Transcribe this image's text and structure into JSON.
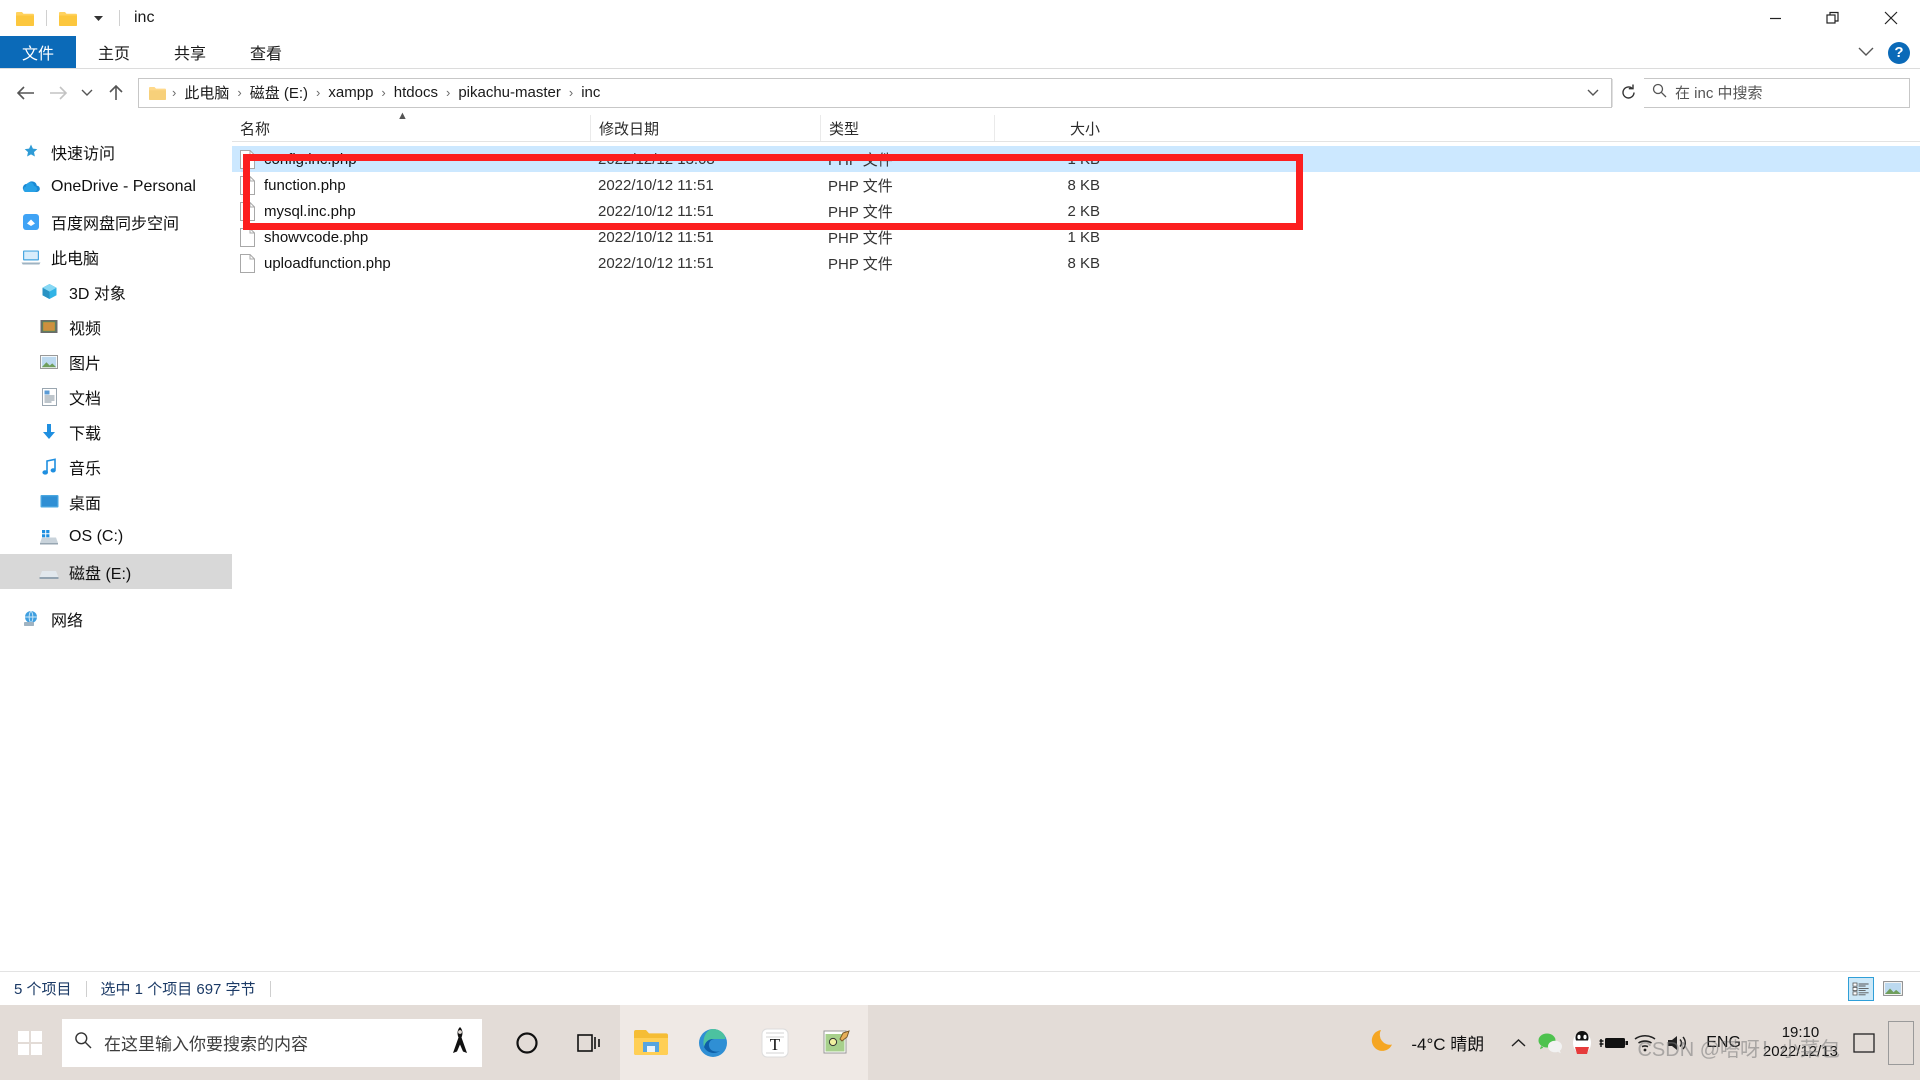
{
  "window": {
    "title": "inc",
    "quick_access_icons": [
      "folder-icon",
      "folder-icon",
      "customize-chevron-icon"
    ],
    "controls": {
      "minimize": "minimize-icon",
      "restore": "restore-icon",
      "close": "close-icon"
    }
  },
  "ribbon": {
    "tabs": [
      {
        "label": "文件",
        "active": true
      },
      {
        "label": "主页",
        "active": false
      },
      {
        "label": "共享",
        "active": false
      },
      {
        "label": "查看",
        "active": false
      }
    ],
    "collapse_icon": "chevron-down-icon",
    "help_label": "?"
  },
  "address": {
    "back_icon": "arrow-left-icon",
    "forward_icon": "arrow-right-icon",
    "recent_icon": "chevron-down-icon",
    "up_icon": "arrow-up-icon",
    "breadcrumbs": [
      "此电脑",
      "磁盘 (E:)",
      "xampp",
      "htdocs",
      "pikachu-master",
      "inc"
    ],
    "separator": "›",
    "dropdown_icon": "chevron-down-icon",
    "refresh_icon": "refresh-icon"
  },
  "search": {
    "placeholder": "在 inc 中搜索",
    "icon": "search-icon"
  },
  "sidebar": {
    "items": [
      {
        "label": "快速访问",
        "icon": "star-pin-icon",
        "indent": false,
        "selected": false
      },
      {
        "label": "OneDrive - Personal",
        "icon": "onedrive-cloud-icon",
        "indent": false,
        "selected": false
      },
      {
        "label": "百度网盘同步空间",
        "icon": "baidu-netdisk-icon",
        "indent": false,
        "selected": false
      },
      {
        "label": "此电脑",
        "icon": "this-pc-icon",
        "indent": false,
        "selected": false
      },
      {
        "label": "3D 对象",
        "icon": "3d-objects-icon",
        "indent": true,
        "selected": false
      },
      {
        "label": "视频",
        "icon": "videos-icon",
        "indent": true,
        "selected": false
      },
      {
        "label": "图片",
        "icon": "pictures-icon",
        "indent": true,
        "selected": false
      },
      {
        "label": "文档",
        "icon": "documents-icon",
        "indent": true,
        "selected": false
      },
      {
        "label": "下载",
        "icon": "downloads-icon",
        "indent": true,
        "selected": false
      },
      {
        "label": "音乐",
        "icon": "music-icon",
        "indent": true,
        "selected": false
      },
      {
        "label": "桌面",
        "icon": "desktop-icon",
        "indent": true,
        "selected": false
      },
      {
        "label": "OS (C:)",
        "icon": "windows-drive-icon",
        "indent": true,
        "selected": false
      },
      {
        "label": "磁盘 (E:)",
        "icon": "drive-icon",
        "indent": true,
        "selected": true
      },
      {
        "label": "网络",
        "icon": "network-icon",
        "indent": false,
        "selected": false
      }
    ]
  },
  "filelist": {
    "columns": [
      {
        "label": "名称",
        "key": "name"
      },
      {
        "label": "修改日期",
        "key": "date"
      },
      {
        "label": "类型",
        "key": "type"
      },
      {
        "label": "大小",
        "key": "size"
      }
    ],
    "sort_indicator": "▲",
    "rows": [
      {
        "name": "config.inc.php",
        "date": "2022/12/12 13:08",
        "type": "PHP 文件",
        "size": "1 KB",
        "selected": true
      },
      {
        "name": "function.php",
        "date": "2022/10/12 11:51",
        "type": "PHP 文件",
        "size": "8 KB",
        "selected": false
      },
      {
        "name": "mysql.inc.php",
        "date": "2022/10/12 11:51",
        "type": "PHP 文件",
        "size": "2 KB",
        "selected": false
      },
      {
        "name": "showvcode.php",
        "date": "2022/10/12 11:51",
        "type": "PHP 文件",
        "size": "1 KB",
        "selected": false
      },
      {
        "name": "uploadfunction.php",
        "date": "2022/10/12 11:51",
        "type": "PHP 文件",
        "size": "8 KB",
        "selected": false
      }
    ]
  },
  "annotation": {
    "color": "#fc1f1f",
    "shape": "rectangle-highlight"
  },
  "statusbar": {
    "item_count": "5 个项目",
    "selection": "选中 1 个项目  697 字节",
    "views": [
      {
        "name": "details-view-button",
        "active": true
      },
      {
        "name": "large-icons-view-button",
        "active": false
      }
    ]
  },
  "taskbar": {
    "start_icon": "windows-start-icon",
    "search_placeholder": "在这里输入你要搜索的内容",
    "search_icon": "search-icon",
    "ribbon_icon": "black-ribbon-icon",
    "apps": [
      {
        "name": "cortana-icon",
        "active": false
      },
      {
        "name": "task-view-icon",
        "active": false
      },
      {
        "name": "file-explorer-icon",
        "active": true
      },
      {
        "name": "microsoft-edge-icon",
        "active": true
      },
      {
        "name": "typora-icon",
        "active": true
      },
      {
        "name": "paint-icon",
        "active": true
      }
    ],
    "tray": {
      "weather_icon": "moon-icon",
      "weather_text": "-4°C  晴朗",
      "overflow_icon": "chevron-up-icon",
      "icons": [
        "wechat-icon",
        "qq-icon",
        "battery-icon",
        "wifi-icon",
        "volume-icon"
      ],
      "language": "ENG",
      "time": "19:10",
      "date": "2022/12/13",
      "notification_icon": "action-center-icon"
    }
  },
  "watermark": {
    "text": "CSDN @嗒呀！小菜包"
  }
}
